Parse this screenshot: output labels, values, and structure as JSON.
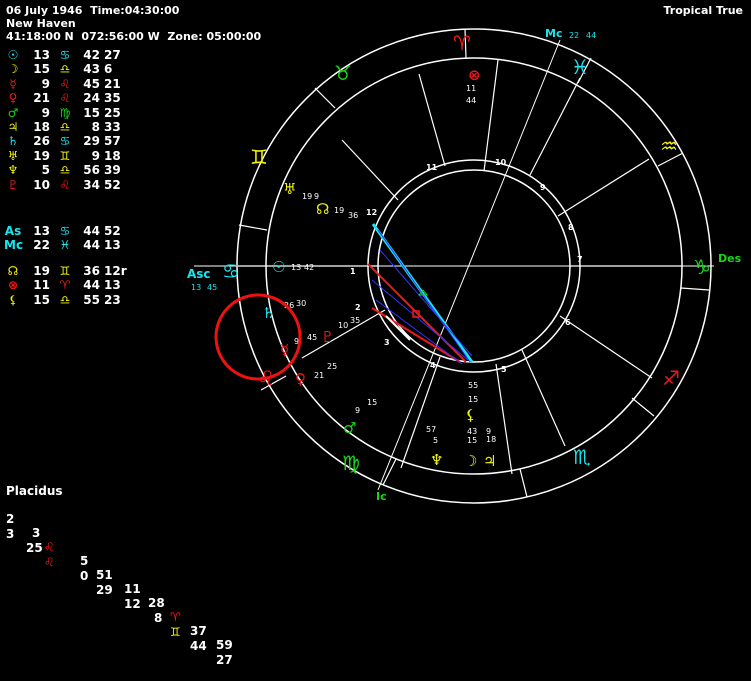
{
  "header": {
    "line1": "06 July 1946  Time:04:30:00",
    "line2": "New Haven",
    "line3": "41:18:00 N  072:56:00 W  Zone: 05:00:00",
    "title": "Tropical True"
  },
  "colors": {
    "cyan": "#19e5ef",
    "yellow": "#f2f20d",
    "red": "#f11818",
    "green": "#17d817",
    "white": "#ffffff",
    "blue": "#3232ff"
  },
  "planets": [
    {
      "glyph": "☉",
      "glyph_name": "sun-icon",
      "color": "#19e5ef",
      "deg": "13",
      "sign": "♋",
      "sign_color": "#19e5ef",
      "min": "42",
      "sec": "27"
    },
    {
      "glyph": "☽",
      "glyph_name": "moon-icon",
      "color": "#f2f20d",
      "deg": "15",
      "sign": "♎",
      "sign_color": "#f2f20d",
      "min": "43",
      "sec": "6"
    },
    {
      "glyph": "☿",
      "glyph_name": "mercury-icon",
      "color": "#f11818",
      "deg": "9",
      "sign": "♌",
      "sign_color": "#f11818",
      "min": "45",
      "sec": "21"
    },
    {
      "glyph": "♀",
      "glyph_name": "venus-icon",
      "color": "#f11818",
      "deg": "21",
      "sign": "♌",
      "sign_color": "#f11818",
      "min": "24",
      "sec": "35"
    },
    {
      "glyph": "♂",
      "glyph_name": "mars-icon",
      "color": "#17d817",
      "deg": "9",
      "sign": "♍",
      "sign_color": "#17d817",
      "min": "15",
      "sec": "25"
    },
    {
      "glyph": "♃",
      "glyph_name": "jupiter-icon",
      "color": "#f2f20d",
      "deg": "18",
      "sign": "♎",
      "sign_color": "#f2f20d",
      "min": "8",
      "sec": "33"
    },
    {
      "glyph": "♄",
      "glyph_name": "saturn-icon",
      "color": "#19e5ef",
      "deg": "26",
      "sign": "♋",
      "sign_color": "#19e5ef",
      "min": "29",
      "sec": "57"
    },
    {
      "glyph": "♅",
      "glyph_name": "uranus-icon",
      "color": "#f2f20d",
      "deg": "19",
      "sign": "♊",
      "sign_color": "#f2f20d",
      "min": "9",
      "sec": "18"
    },
    {
      "glyph": "♆",
      "glyph_name": "neptune-icon",
      "color": "#f2f20d",
      "deg": "5",
      "sign": "♎",
      "sign_color": "#f2f20d",
      "min": "56",
      "sec": "39"
    },
    {
      "glyph": "♇",
      "glyph_name": "pluto-icon",
      "color": "#f11818",
      "deg": "10",
      "sign": "♌",
      "sign_color": "#f11818",
      "min": "34",
      "sec": "52"
    }
  ],
  "angles": [
    {
      "glyph": "As",
      "glyph_name": "ascendant-label",
      "color": "#19e5ef",
      "deg": "13",
      "sign": "♋",
      "sign_color": "#19e5ef",
      "min": "44",
      "sec": "52"
    },
    {
      "glyph": "Mc",
      "glyph_name": "midheaven-label",
      "color": "#19e5ef",
      "deg": "22",
      "sign": "♓",
      "sign_color": "#19e5ef",
      "min": "44",
      "sec": "13"
    }
  ],
  "points": [
    {
      "glyph": "☊",
      "glyph_name": "north-node-icon",
      "color": "#f2f20d",
      "deg": "19",
      "sign": "♊",
      "sign_color": "#f2f20d",
      "min": "36",
      "sec": "12r"
    },
    {
      "glyph": "⊗",
      "glyph_name": "part-of-fortune-icon",
      "color": "#f11818",
      "deg": "11",
      "sign": "♈",
      "sign_color": "#f11818",
      "min": "44",
      "sec": "13"
    },
    {
      "glyph": "⚸",
      "glyph_name": "lilith-icon",
      "color": "#f2f20d",
      "deg": "15",
      "sign": "♎",
      "sign_color": "#f2f20d",
      "min": "55",
      "sec": "23"
    }
  ],
  "houses": {
    "title": "Placidus",
    "row1": [
      {
        "h": "2",
        "deg": "3",
        "sign": "♌",
        "sign_color": "#f11818",
        "min": "5"
      },
      {
        "h": "51",
        "deg": "11",
        "sign": "",
        "sign_color": "#fff",
        "min": "28"
      },
      {
        "h": "",
        "deg": "",
        "sign": "♈",
        "sign_color": "#f11818",
        "min": "37",
        "sec": "59"
      }
    ],
    "row1_text": [
      "2",
      "3",
      "5",
      "51",
      "11",
      "28",
      "37",
      "59"
    ],
    "row2_text": [
      "3",
      "25",
      "0",
      "29",
      "12",
      "8",
      "44",
      "27"
    ]
  },
  "wheel": {
    "house_numbers": [
      "1",
      "2",
      "3",
      "4",
      "5",
      "6",
      "7",
      "8",
      "9",
      "10",
      "11",
      "12"
    ],
    "asc_label": "Asc",
    "asc_deg": "13",
    "asc_min": "45",
    "des_label": "Des",
    "mc_label": "Mc",
    "mc_deg": "22",
    "mc_min": "44",
    "ic_label": "Ic",
    "planet_labels": [
      {
        "name": "part-of-fortune-label",
        "text1": "11",
        "text2": "44"
      },
      {
        "name": "uranus-label",
        "text1": "19",
        "text2": "9"
      },
      {
        "name": "north-node-label",
        "text1": "19",
        "text2": "36"
      },
      {
        "name": "sun-label",
        "text1": "13",
        "text2": "42"
      },
      {
        "name": "saturn-label",
        "text1": "26",
        "text2": "30"
      },
      {
        "name": "mercury-label",
        "text1": "9",
        "text2": "45"
      },
      {
        "name": "pluto-label",
        "text1": "10",
        "text2": "35"
      },
      {
        "name": "venus-label",
        "text1": "21",
        "text2": "25"
      },
      {
        "name": "mars-label",
        "text1": "9",
        "text2": "15"
      },
      {
        "name": "neptune-label",
        "text1": "5",
        "text2": "57"
      },
      {
        "name": "moon-label",
        "text1": "15",
        "text2": "43"
      },
      {
        "name": "jupiter-label",
        "text1": "18",
        "text2": "9"
      },
      {
        "name": "lilith-label",
        "text1": "15",
        "text2": "55"
      }
    ]
  }
}
